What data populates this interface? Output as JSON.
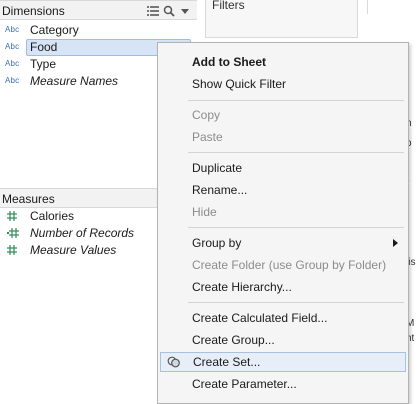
{
  "dimensions": {
    "title": "Dimensions",
    "fields": [
      {
        "type": "Abc",
        "label": "Category"
      },
      {
        "type": "Abc",
        "label": "Food"
      },
      {
        "type": "Abc",
        "label": "Type"
      },
      {
        "type": "Abc",
        "label": "Measure Names"
      }
    ]
  },
  "measures": {
    "title": "Measures",
    "fields": [
      {
        "label": "Calories"
      },
      {
        "label": "Number of Records"
      },
      {
        "label": "Measure Values"
      }
    ]
  },
  "filters_card": {
    "title": "Filters"
  },
  "edge_fragments": [
    "n",
    "o",
    "r",
    "lis",
    "M",
    "ht"
  ],
  "context_menu": {
    "items": [
      {
        "label": "Add to Sheet"
      },
      {
        "label": "Show Quick Filter"
      },
      {
        "label": "Copy"
      },
      {
        "label": "Paste"
      },
      {
        "label": "Duplicate"
      },
      {
        "label": "Rename..."
      },
      {
        "label": "Hide"
      },
      {
        "label": "Group by"
      },
      {
        "label": "Create Folder (use Group by Folder)"
      },
      {
        "label": "Create Hierarchy..."
      },
      {
        "label": "Create Calculated Field..."
      },
      {
        "label": "Create Group..."
      },
      {
        "label": "Create Set..."
      },
      {
        "label": "Create Parameter..."
      }
    ]
  },
  "colors": {
    "selection": "#d6e4f5",
    "type_icon": "#3a6db5",
    "measure_icon": "#2e8b57"
  }
}
